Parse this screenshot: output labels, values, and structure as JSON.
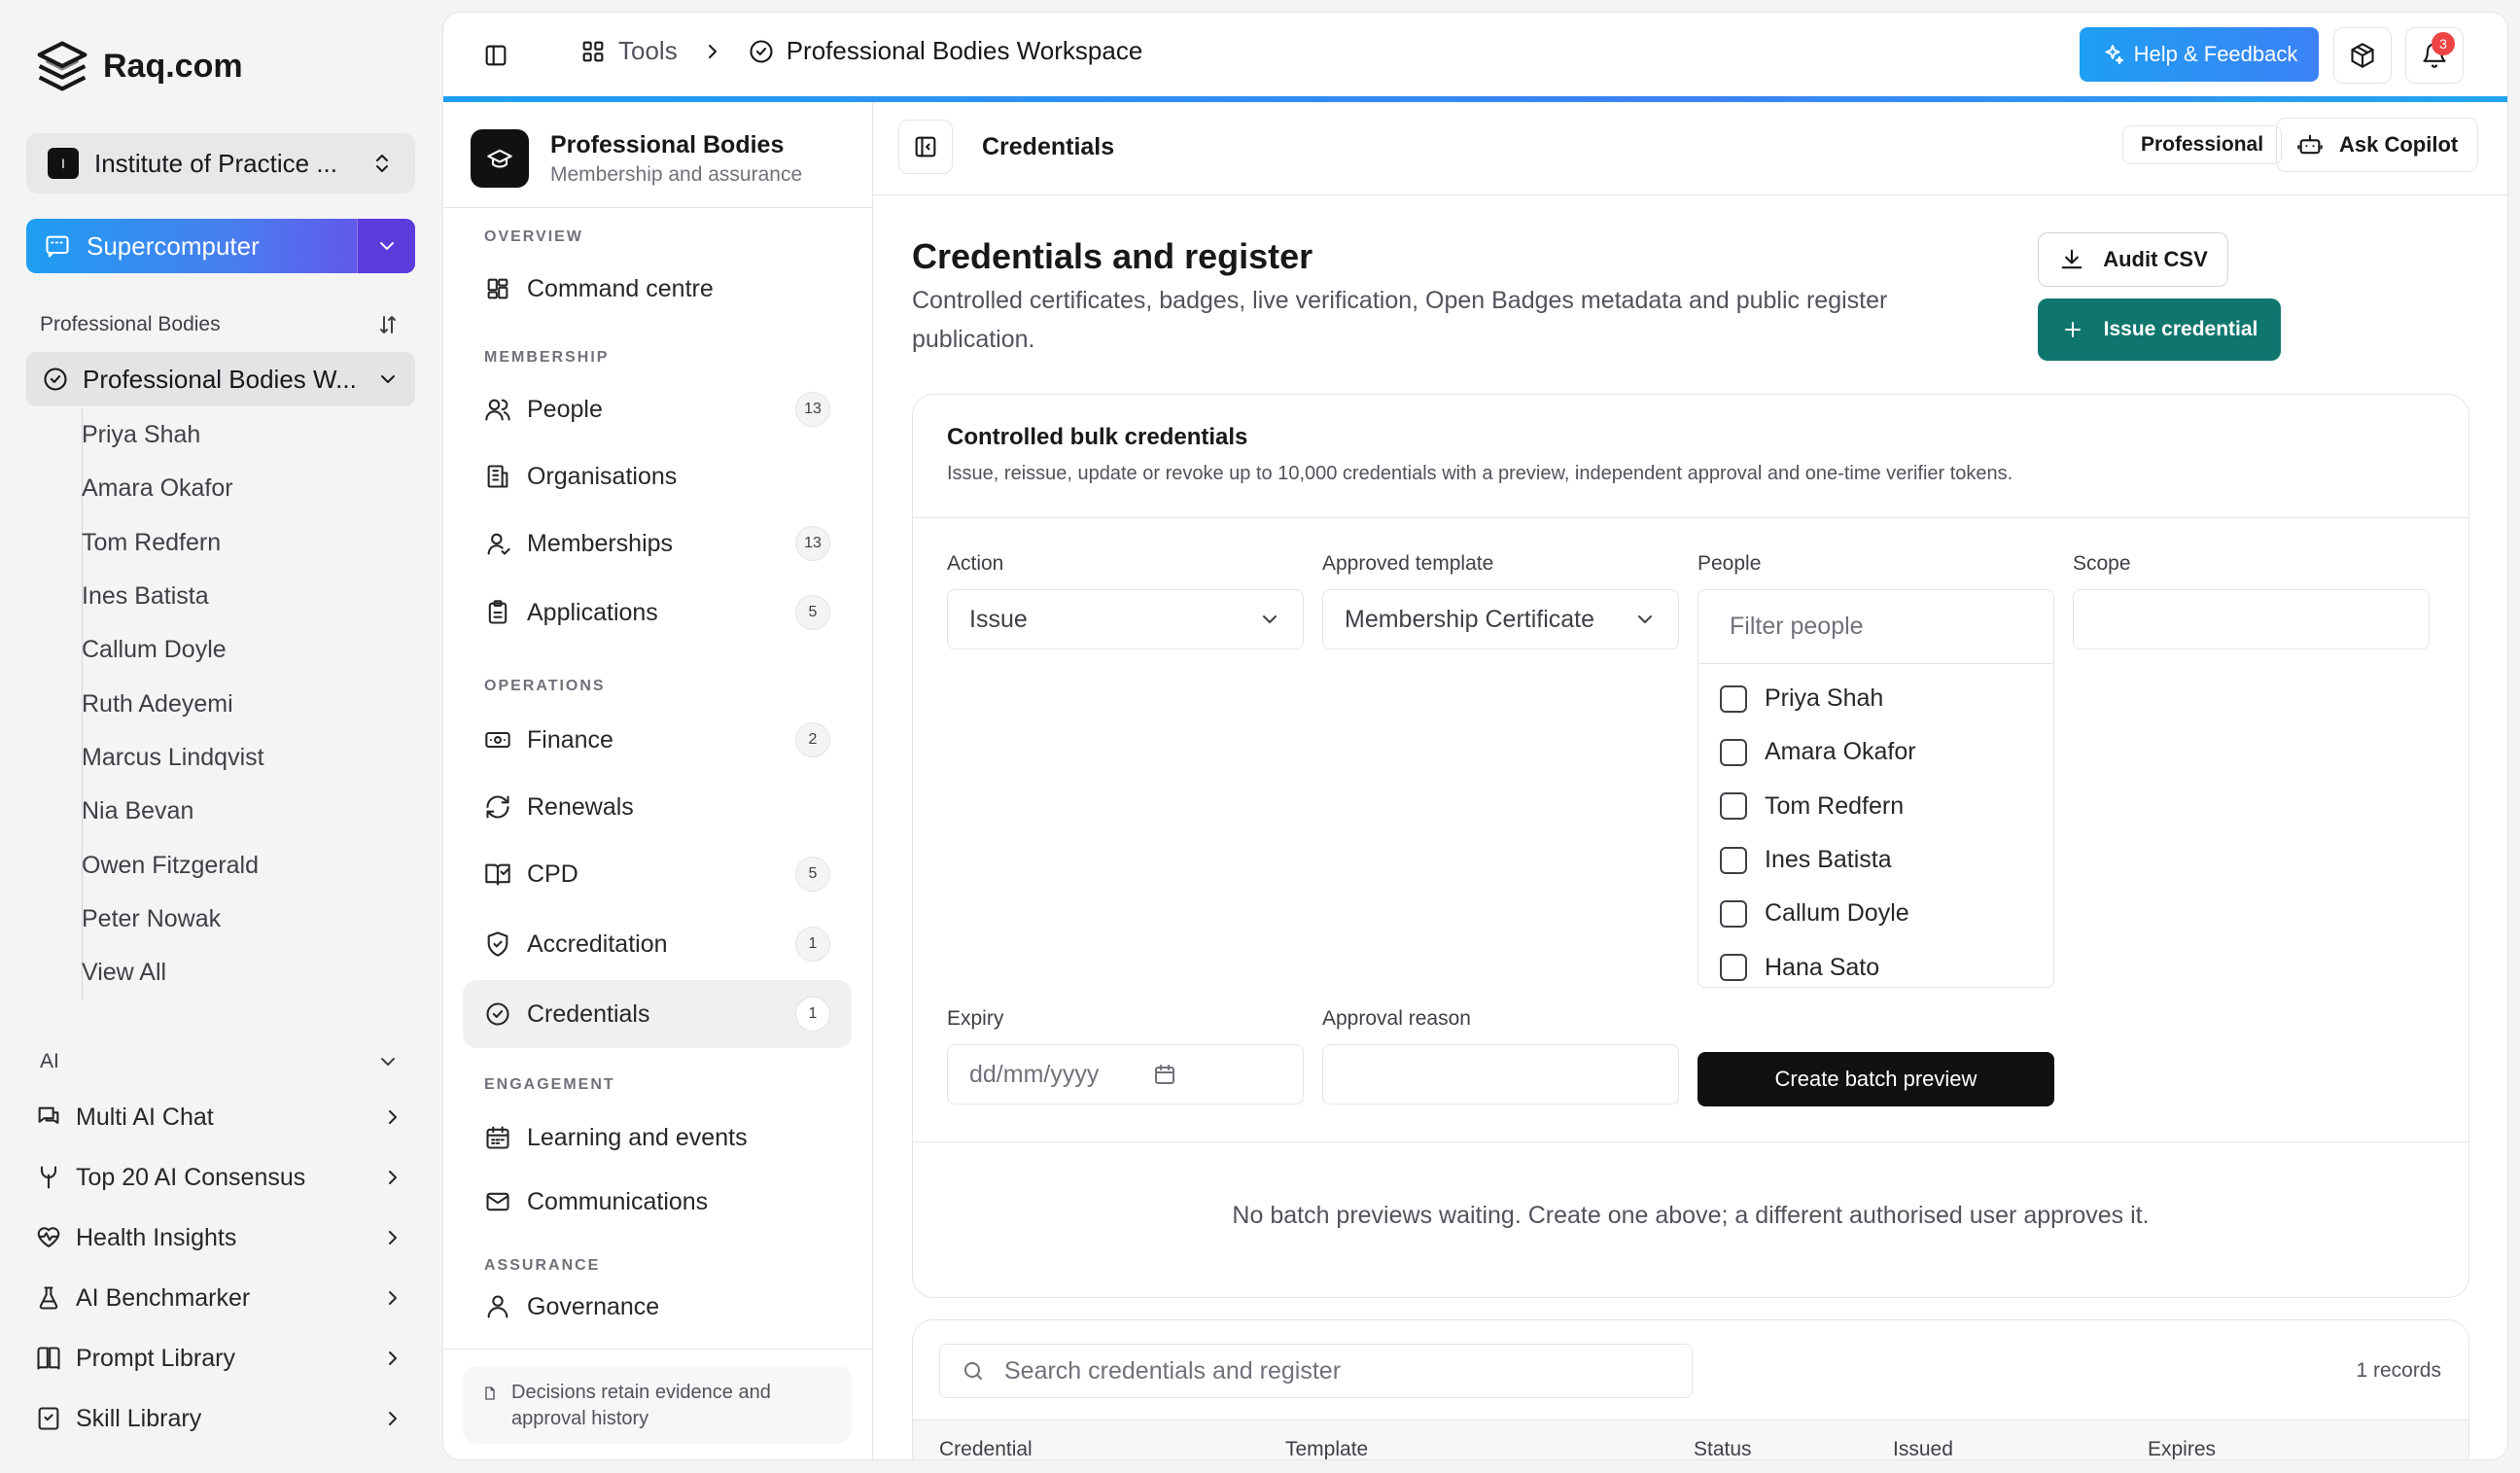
{
  "brand": {
    "name": "Raq.com"
  },
  "org": {
    "avatar_letter": "I",
    "name": "Institute of Practice ..."
  },
  "supercomputer": {
    "label": "Supercomputer"
  },
  "sidebar": {
    "section_title": "Professional Bodies",
    "workspace_label": "Professional Bodies W...",
    "people": [
      "Priya Shah",
      "Amara Okafor",
      "Tom Redfern",
      "Ines Batista",
      "Callum Doyle",
      "Ruth Adeyemi",
      "Marcus Lindqvist",
      "Nia Bevan",
      "Owen Fitzgerald",
      "Peter Nowak",
      "View All"
    ],
    "ai_section": "AI",
    "ai_items": [
      {
        "label": "Multi AI Chat",
        "icon": "chat-icon"
      },
      {
        "label": "Top 20 AI Consensus",
        "icon": "merge-icon"
      },
      {
        "label": "Health Insights",
        "icon": "heart-pulse-icon"
      },
      {
        "label": "AI Benchmarker",
        "icon": "flask-icon"
      },
      {
        "label": "Prompt Library",
        "icon": "book-icon"
      },
      {
        "label": "Skill Library",
        "icon": "skill-book-icon"
      }
    ]
  },
  "topbar": {
    "crumb_tools": "Tools",
    "crumb_workspace": "Professional Bodies Workspace",
    "help_label": "Help & Feedback",
    "notification_count": "3"
  },
  "subnav": {
    "title": "Professional Bodies",
    "subtitle": "Membership and assurance",
    "sections": {
      "overview": "OVERVIEW",
      "membership": "MEMBERSHIP",
      "operations": "OPERATIONS",
      "engagement": "ENGAGEMENT",
      "assurance": "ASSURANCE"
    },
    "items": {
      "command": {
        "label": "Command centre"
      },
      "people": {
        "label": "People",
        "count": "13"
      },
      "organisations": {
        "label": "Organisations"
      },
      "memberships": {
        "label": "Memberships",
        "count": "13"
      },
      "applications": {
        "label": "Applications",
        "count": "5"
      },
      "finance": {
        "label": "Finance",
        "count": "2"
      },
      "renewals": {
        "label": "Renewals"
      },
      "cpd": {
        "label": "CPD",
        "count": "5"
      },
      "accreditation": {
        "label": "Accreditation",
        "count": "1"
      },
      "credentials": {
        "label": "Credentials",
        "count": "1"
      },
      "learning": {
        "label": "Learning and events"
      },
      "communications": {
        "label": "Communications"
      },
      "governance": {
        "label": "Governance"
      }
    },
    "footer": "Decisions retain evidence and approval history"
  },
  "content": {
    "header_title": "Credentials",
    "chip_professional": "Professional",
    "ask_copilot": "Ask Copilot",
    "page_title": "Credentials and register",
    "page_desc": "Controlled certificates, badges, live verification, Open Badges metadata and public register publication.",
    "audit_csv": "Audit CSV",
    "issue_credential": "Issue credential"
  },
  "bulk": {
    "title": "Controlled bulk credentials",
    "subtitle": "Issue, reissue, update or revoke up to 10,000 credentials with a preview, independent approval and one-time verifier tokens.",
    "action_label": "Action",
    "action_value": "Issue",
    "template_label": "Approved template",
    "template_value": "Membership Certificate",
    "people_label": "People",
    "people_placeholder": "Filter people",
    "people": [
      "Priya Shah",
      "Amara Okafor",
      "Tom Redfern",
      "Ines Batista",
      "Callum Doyle",
      "Hana Sato"
    ],
    "scope_label": "Scope",
    "expiry_label": "Expiry",
    "expiry_placeholder": "dd/mm/yyyy",
    "reason_label": "Approval reason",
    "create_preview": "Create batch preview",
    "empty_message": "No batch previews waiting. Create one above; a different authorised user approves it."
  },
  "register": {
    "search_placeholder": "Search credentials and register",
    "records": "1 records",
    "columns": [
      "Credential",
      "Template",
      "Status",
      "Issued",
      "Expires"
    ]
  },
  "colors": {
    "accent": "#1e9ff2",
    "primary_teal": "#0f766e",
    "badge_red": "#ef4444"
  }
}
